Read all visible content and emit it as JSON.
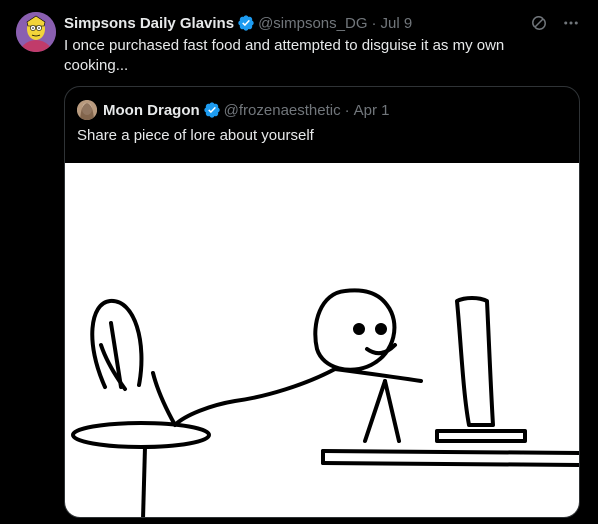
{
  "tweet": {
    "author_name": "Simpsons Daily Glavins",
    "handle": "@simpsons_DG",
    "date": "Jul 9",
    "text": "I once purchased fast food and attempted to disguise it as my own cooking...",
    "icons": [
      "verified-badge-icon",
      "grok-icon",
      "more-icon"
    ]
  },
  "quote": {
    "author_name": "Moon Dragon",
    "handle": "@frozenaesthetic",
    "date": "Apr 1",
    "text": "Share a piece of lore about yourself",
    "media": "stick-figure-drawing"
  },
  "colors": {
    "background": "#000000",
    "text": "#e7e9ea",
    "muted": "#71767b",
    "verified": "#1d9bf0",
    "border": "#2f3336"
  }
}
